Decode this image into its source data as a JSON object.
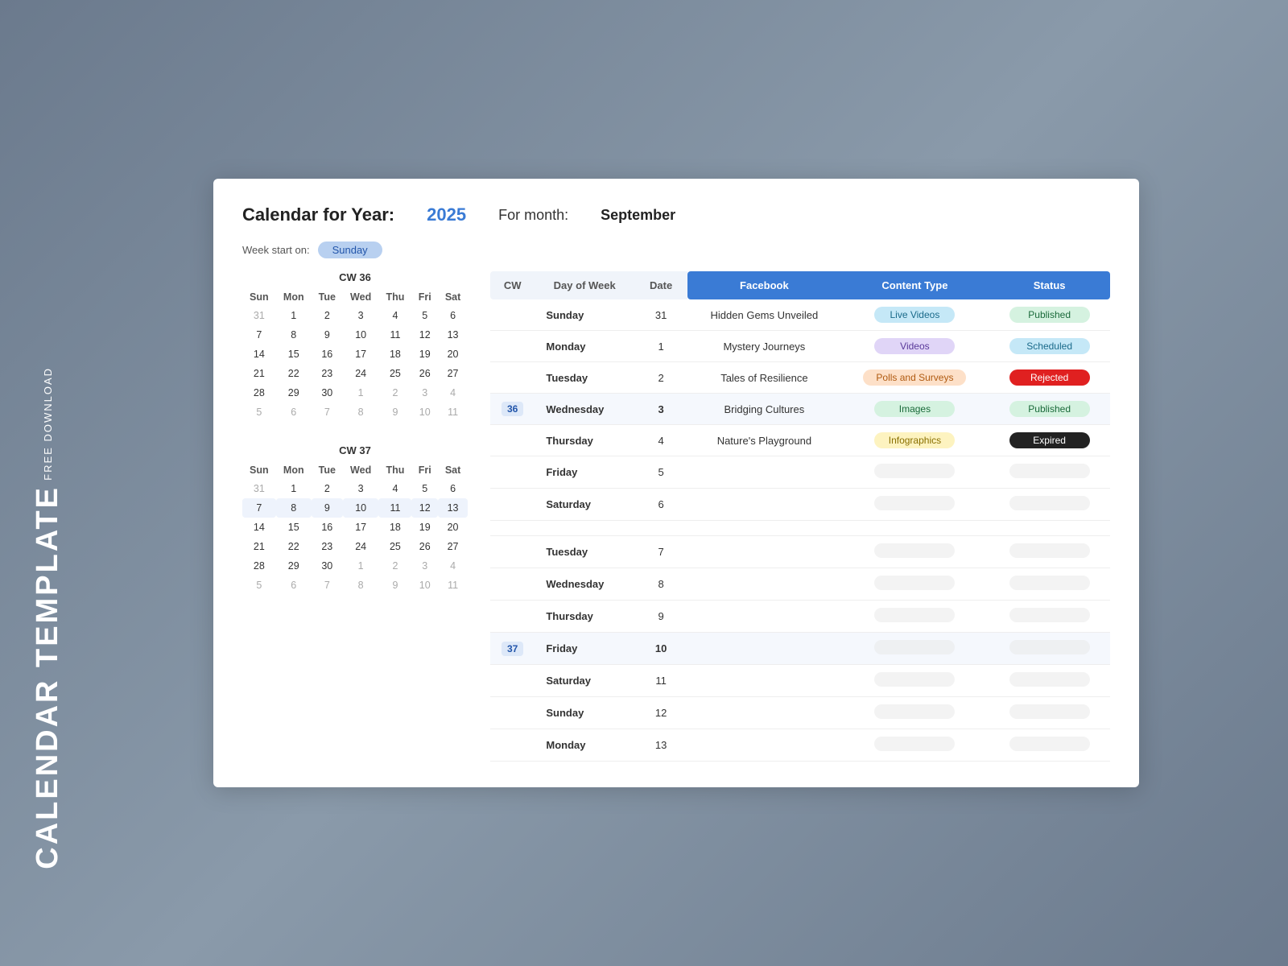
{
  "sidebar": {
    "free_download": "FREE DOWNLOAD",
    "calendar_template": "CALENDAR TEMPLATE"
  },
  "header": {
    "title": "Calendar for Year:",
    "year": "2025",
    "for_month_label": "For month:",
    "month": "September",
    "week_start_label": "Week start on:",
    "week_start_value": "Sunday"
  },
  "calendar": {
    "cw36_label": "CW 36",
    "cw37_label": "CW 37",
    "day_headers": [
      "Sun",
      "Mon",
      "Tue",
      "Wed",
      "Thu",
      "Fri",
      "Sat"
    ],
    "weeks_cw36": [
      [
        "31",
        "1",
        "2",
        "3",
        "4",
        "5",
        "6"
      ],
      [
        "7",
        "8",
        "9",
        "10",
        "11",
        "12",
        "13"
      ],
      [
        "14",
        "15",
        "16",
        "17",
        "18",
        "19",
        "20"
      ],
      [
        "21",
        "22",
        "23",
        "24",
        "25",
        "26",
        "27"
      ],
      [
        "28",
        "29",
        "30",
        "1",
        "2",
        "3",
        "4"
      ],
      [
        "5",
        "6",
        "7",
        "8",
        "9",
        "10",
        "11"
      ]
    ],
    "weeks_cw37": [
      [
        "31",
        "1",
        "2",
        "3",
        "4",
        "5",
        "6"
      ],
      [
        "7",
        "8",
        "9",
        "10",
        "11",
        "12",
        "13"
      ],
      [
        "14",
        "15",
        "16",
        "17",
        "18",
        "19",
        "20"
      ],
      [
        "21",
        "22",
        "23",
        "24",
        "25",
        "26",
        "27"
      ],
      [
        "28",
        "29",
        "30",
        "1",
        "2",
        "3",
        "4"
      ],
      [
        "5",
        "6",
        "7",
        "8",
        "9",
        "10",
        "11"
      ]
    ]
  },
  "schedule_table": {
    "headers": {
      "cw": "CW",
      "day_of_week": "Day of Week",
      "date": "Date",
      "facebook": "Facebook",
      "content_type": "Content Type",
      "status": "Status"
    },
    "cw36_rows": [
      {
        "cw": "",
        "day": "Sunday",
        "date": "31",
        "facebook": "Hidden Gems Unveiled",
        "content_type": "Live Videos",
        "status": "Published",
        "ct_class": "badge-live-videos",
        "st_class": "badge-published-green"
      },
      {
        "cw": "",
        "day": "Monday",
        "date": "1",
        "facebook": "Mystery Journeys",
        "content_type": "Videos",
        "status": "Scheduled",
        "ct_class": "badge-videos",
        "st_class": "badge-scheduled"
      },
      {
        "cw": "",
        "day": "Tuesday",
        "date": "2",
        "facebook": "Tales of Resilience",
        "content_type": "Polls and Surveys",
        "status": "Rejected",
        "ct_class": "badge-polls",
        "st_class": "badge-rejected"
      },
      {
        "cw": "36",
        "day": "Wednesday",
        "date": "3",
        "facebook": "Bridging Cultures",
        "content_type": "Images",
        "status": "Published",
        "ct_class": "badge-images",
        "st_class": "badge-published-green2"
      },
      {
        "cw": "",
        "day": "Thursday",
        "date": "4",
        "facebook": "Nature's Playground",
        "content_type": "Infographics",
        "status": "Expired",
        "ct_class": "badge-infographics",
        "st_class": "badge-expired"
      },
      {
        "cw": "",
        "day": "Friday",
        "date": "5",
        "facebook": "",
        "content_type": "",
        "status": "",
        "ct_class": "",
        "st_class": ""
      },
      {
        "cw": "",
        "day": "Saturday",
        "date": "6",
        "facebook": "",
        "content_type": "",
        "status": "",
        "ct_class": "",
        "st_class": ""
      }
    ],
    "cw37_rows": [
      {
        "cw": "",
        "day": "Tuesday",
        "date": "7",
        "facebook": "",
        "content_type": "",
        "status": ""
      },
      {
        "cw": "",
        "day": "Wednesday",
        "date": "8",
        "facebook": "",
        "content_type": "",
        "status": ""
      },
      {
        "cw": "",
        "day": "Thursday",
        "date": "9",
        "facebook": "",
        "content_type": "",
        "status": ""
      },
      {
        "cw": "37",
        "day": "Friday",
        "date": "10",
        "facebook": "",
        "content_type": "",
        "status": ""
      },
      {
        "cw": "",
        "day": "Saturday",
        "date": "11",
        "facebook": "",
        "content_type": "",
        "status": ""
      },
      {
        "cw": "",
        "day": "Sunday",
        "date": "12",
        "facebook": "",
        "content_type": "",
        "status": ""
      },
      {
        "cw": "",
        "day": "Monday",
        "date": "13",
        "facebook": "",
        "content_type": "",
        "status": ""
      }
    ]
  }
}
